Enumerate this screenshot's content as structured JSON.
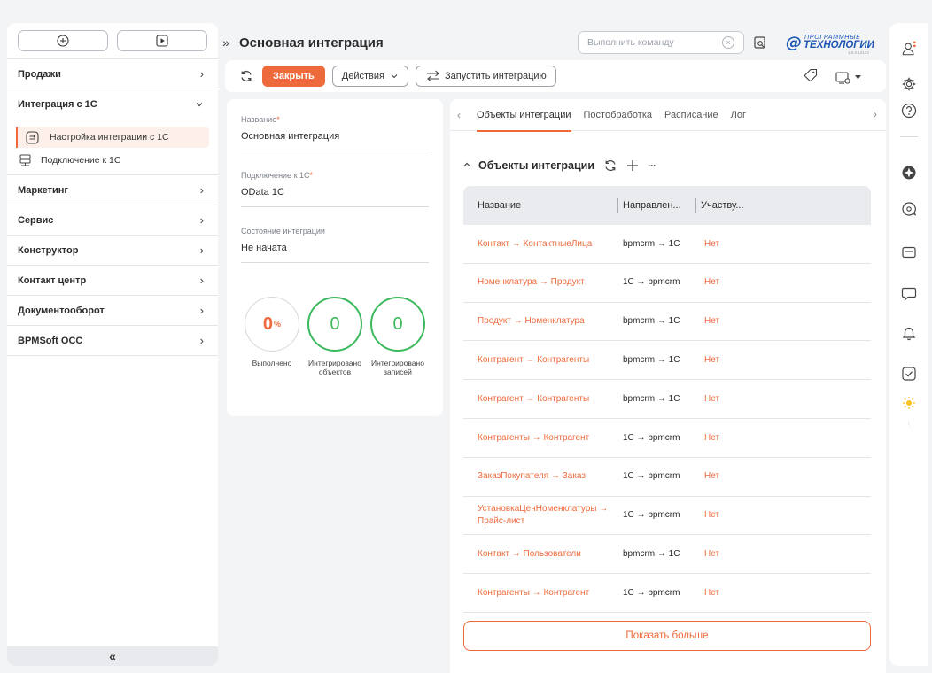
{
  "sidebar": {
    "menu": [
      {
        "label": "Продажи"
      },
      {
        "label": "Интеграция с 1С"
      },
      {
        "label": "Маркетинг"
      },
      {
        "label": "Сервис"
      },
      {
        "label": "Конструктор"
      },
      {
        "label": "Контакт центр"
      },
      {
        "label": "Документооборот"
      },
      {
        "label": "BPMSoft OCC"
      }
    ],
    "submenu": [
      {
        "label": "Настройка интеграции с 1С",
        "active": true
      },
      {
        "label": "Подключение к 1С",
        "active": false
      }
    ],
    "collapse_glyph": "«"
  },
  "header": {
    "expand_glyph": "»",
    "title": "Основная интеграция",
    "command_placeholder": "Выполнить команду",
    "logo_top": "ПРОГРАММНЫЕ",
    "logo_main": "ТЕХНОЛОГИИ",
    "logo_version": "1.6.0.14133"
  },
  "toolbar": {
    "close_label": "Закрыть",
    "actions_label": "Действия",
    "run_label": "Запустить интеграцию"
  },
  "form": {
    "name_label": "Название",
    "name_value": "Основная интеграция",
    "connection_label": "Подключение к 1С",
    "connection_value": "OData 1C",
    "state_label": "Состояние интеграции",
    "state_value": "Не начата",
    "required_mark": "*"
  },
  "stats": {
    "done_value": "0",
    "done_unit": "%",
    "done_label": "Выполнено",
    "objects_value": "0",
    "objects_label": "Интегрировано объектов",
    "records_value": "0",
    "records_label": "Интегрировано записей"
  },
  "tabs": [
    {
      "label": "Объекты интеграции",
      "active": true
    },
    {
      "label": "Постобработка",
      "active": false
    },
    {
      "label": "Расписание",
      "active": false
    },
    {
      "label": "Лог",
      "active": false
    }
  ],
  "section": {
    "title": "Объекты интеграции",
    "more_glyph": "···"
  },
  "table": {
    "headers": [
      "Название",
      "Направлен...",
      "Участву..."
    ],
    "rows": [
      {
        "name": "Контакт → КонтактныеЛица",
        "direction": "bpmcrm → 1C",
        "participates": "Нет"
      },
      {
        "name": "Номенклатура → Продукт",
        "direction": "1C → bpmcrm",
        "participates": "Нет"
      },
      {
        "name": "Продукт → Номенклатура",
        "direction": "bpmcrm → 1C",
        "participates": "Нет"
      },
      {
        "name": "Контрагент → Контрагенты",
        "direction": "bpmcrm → 1C",
        "participates": "Нет"
      },
      {
        "name": "Контрагент → Контрагенты",
        "direction": "bpmcrm → 1C",
        "participates": "Нет"
      },
      {
        "name": "Контрагенты → Контрагент",
        "direction": "1C → bpmcrm",
        "participates": "Нет"
      },
      {
        "name": "ЗаказПокупателя → Заказ",
        "direction": "1C → bpmcrm",
        "participates": "Нет"
      },
      {
        "name": "УстановкаЦенНоменклатуры → Прайс-лист",
        "direction": "1C → bpmcrm",
        "participates": "Нет"
      },
      {
        "name": "Контакт → Пользователи",
        "direction": "bpmcrm → 1C",
        "participates": "Нет"
      },
      {
        "name": "Контрагенты → Контрагент",
        "direction": "1C → bpmcrm",
        "participates": "Нет"
      }
    ],
    "show_more_label": "Показать больше"
  },
  "colors": {
    "accent": "#ee6a3c",
    "success": "#3cb95c",
    "logo_blue": "#1d56b3"
  }
}
